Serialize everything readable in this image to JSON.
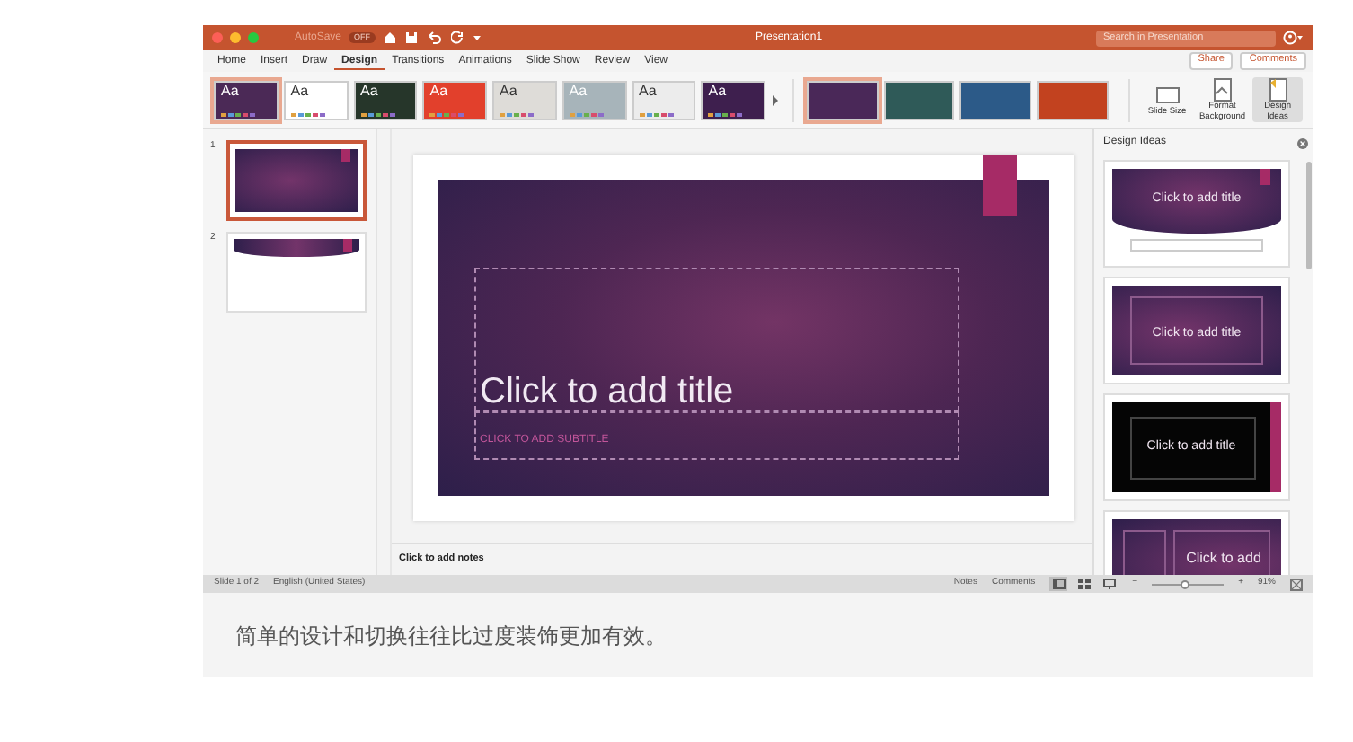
{
  "window": {
    "autosave_label": "AutoSave",
    "autosave_state": "OFF",
    "title": "Presentation1",
    "search": {
      "placeholder": "Search in Presentation"
    }
  },
  "tabs": [
    {
      "label": "Home",
      "selected": false
    },
    {
      "label": "Insert",
      "selected": false
    },
    {
      "label": "Draw",
      "selected": false
    },
    {
      "label": "Design",
      "selected": true
    },
    {
      "label": "Transitions",
      "selected": false
    },
    {
      "label": "Animations",
      "selected": false
    },
    {
      "label": "Slide Show",
      "selected": false
    },
    {
      "label": "Review",
      "selected": false
    },
    {
      "label": "View",
      "selected": false
    }
  ],
  "share": "Share",
  "comments": "Comments",
  "themes": [
    {
      "label": "Aa",
      "selected": true,
      "color": "#4b2956"
    },
    {
      "label": "Aa",
      "selected": false,
      "color": "#ffffff"
    },
    {
      "label": "Aa",
      "selected": false,
      "color": "#26362a"
    },
    {
      "label": "Aa",
      "selected": false,
      "color": "#e2402c"
    },
    {
      "label": "Aa",
      "selected": false,
      "color": "#dedcd8"
    },
    {
      "label": "Aa",
      "selected": false,
      "color": "#a7b4ba"
    },
    {
      "label": "Aa",
      "selected": false,
      "color": "#ececec"
    },
    {
      "label": "Aa",
      "selected": false,
      "color": "#3e1f4e"
    }
  ],
  "variants": [
    {
      "selected": true,
      "color": "#4a2858"
    },
    {
      "selected": false,
      "color": "#2f5a58"
    },
    {
      "selected": false,
      "color": "#2c5a88"
    },
    {
      "selected": false,
      "color": "#c2421f"
    }
  ],
  "ribbon_buttons": [
    {
      "kind": "size",
      "label": "Slide Size"
    },
    {
      "kind": "background",
      "label": "Format Background"
    },
    {
      "kind": "ideas",
      "label": "Design Ideas"
    }
  ],
  "slides": [
    {
      "number": "1",
      "selected": true,
      "kind": "full"
    },
    {
      "number": "2",
      "selected": false,
      "kind": "banner"
    }
  ],
  "slide": {
    "title": "Click to add title",
    "subtitle": "CLICK TO ADD SUBTITLE"
  },
  "notes": {
    "placeholder": "Click to add notes"
  },
  "design_ideas": {
    "title": "Design Ideas",
    "ideas": [
      {
        "kind": "arc",
        "title": "Click to add title"
      },
      {
        "kind": "framed",
        "title": "Click to add title"
      },
      {
        "kind": "black",
        "title": "Click to add title"
      },
      {
        "kind": "split",
        "title": "Click to add"
      }
    ]
  },
  "status_bar": {
    "slide_info": "Slide 1 of 2",
    "language": "English (United States)",
    "notes": "Notes",
    "comments": "Comments",
    "views": [
      {
        "kind": "normal",
        "selected": true
      },
      {
        "kind": "sorter",
        "selected": false
      },
      {
        "kind": "reading",
        "selected": false
      }
    ],
    "zoom_out": "−",
    "zoom_in": "+",
    "zoom": {
      "level": 0.45
    },
    "zoom_text": "91%"
  },
  "caption": "简单的设计和切换往往比过度装饰更加有效。"
}
